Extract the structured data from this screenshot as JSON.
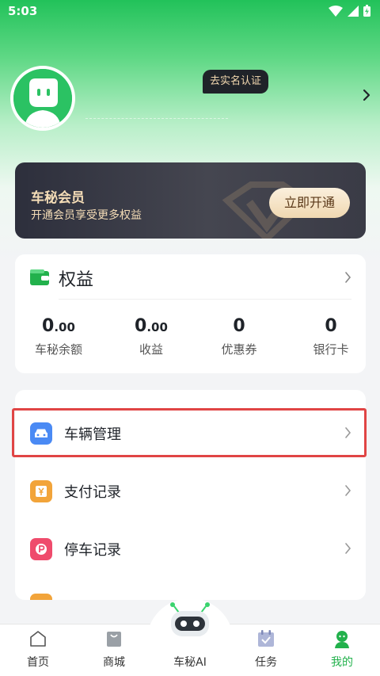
{
  "status_bar": {
    "time": "5:03"
  },
  "profile": {
    "verify_label": "去实名认证"
  },
  "vip": {
    "title": "车秘会员",
    "subtitle": "开通会员享受更多权益",
    "button_label": "立即开通"
  },
  "benefits": {
    "title": "权益",
    "stats": [
      {
        "int": "0",
        "dec": ".00",
        "label": "车秘余额"
      },
      {
        "int": "0",
        "dec": ".00",
        "label": "收益"
      },
      {
        "int": "0",
        "dec": "",
        "label": "优惠券"
      },
      {
        "int": "0",
        "dec": "",
        "label": "银行卡"
      }
    ]
  },
  "menu": {
    "items": [
      {
        "label": "车辆管理",
        "icon": "car-icon",
        "color": "#4a8af4"
      },
      {
        "label": "支付记录",
        "icon": "yen-icon",
        "color": "#f2a43a"
      },
      {
        "label": "停车记录",
        "icon": "parking-icon",
        "color": "#ef4b6c"
      }
    ]
  },
  "tabbar": {
    "tabs": [
      {
        "label": "首页",
        "icon": "home-icon"
      },
      {
        "label": "商城",
        "icon": "shopping-bag-icon"
      },
      {
        "label": "车秘AI",
        "icon": "robot-icon"
      },
      {
        "label": "任务",
        "icon": "calendar-check-icon"
      },
      {
        "label": "我的",
        "icon": "user-icon"
      }
    ],
    "active": "我的"
  },
  "colors": {
    "brand": "#22b14c",
    "vip_gold": "#f5ddb7",
    "highlight": "#e04545"
  }
}
